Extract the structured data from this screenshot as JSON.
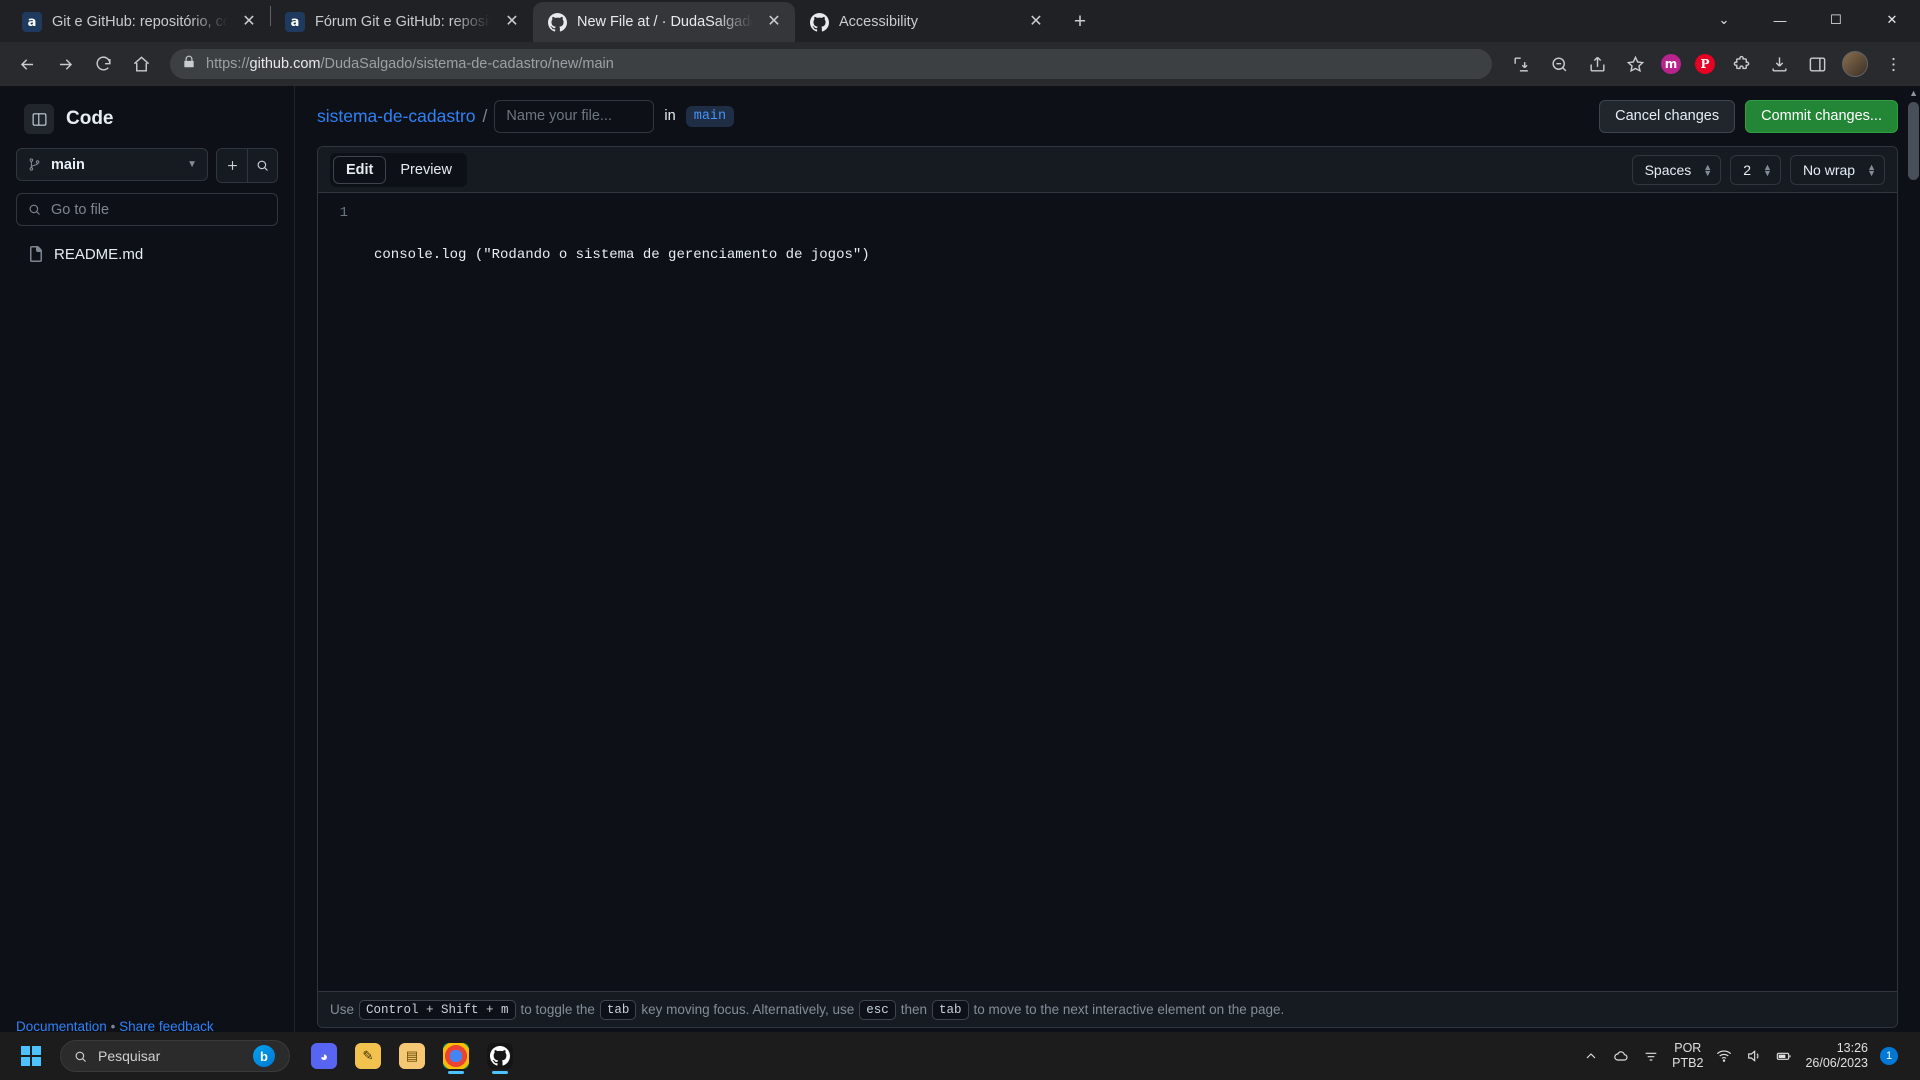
{
  "browser": {
    "tabs": [
      {
        "title": "Git e GitHub: repositório, commit e",
        "favicon": "alura-icon",
        "active": false
      },
      {
        "title": "Fórum Git e GitHub: repositório, com",
        "favicon": "alura-icon",
        "active": false
      },
      {
        "title": "New File at / · DudaSalgado/sistema",
        "favicon": "github-icon",
        "active": true
      },
      {
        "title": "Accessibility",
        "favicon": "github-icon",
        "active": false
      }
    ],
    "new_tab_label": "+",
    "window_controls": {
      "minimize": "—",
      "maximize": "☐",
      "close": "✕",
      "more_tabs": "⌄"
    },
    "toolbar": {
      "back_icon": "back-arrow-icon",
      "forward_icon": "forward-arrow-icon",
      "reload_icon": "reload-icon",
      "home_icon": "home-icon",
      "lock_icon": "lock-icon",
      "url_protocol": "https://",
      "url_domain": "github.com",
      "url_path": "/DudaSalgado/sistema-de-cadastro/new/main",
      "install_icon": "install-app-icon",
      "zoom_icon": "zoom-out-icon",
      "share_icon": "share-icon",
      "bookmark_icon": "star-icon",
      "ext_m_label": "m",
      "ext_p_label": "P",
      "puzzle_icon": "extensions-puzzle-icon",
      "downloads_icon": "downloads-icon",
      "sidepanel_icon": "side-panel-icon",
      "profile_icon": "profile-avatar",
      "menu_icon": "three-dot-menu-icon"
    }
  },
  "github": {
    "sidebar": {
      "panel_toggle_icon": "side-panel-collapse-icon",
      "title": "Code",
      "branch_icon": "git-branch-icon",
      "branch_name": "main",
      "add_file_icon": "plus-icon",
      "search_files_icon": "search-icon",
      "goto_file_icon": "search-icon",
      "goto_file_placeholder": "Go to file",
      "files": [
        {
          "name": "README.md",
          "icon": "file-icon"
        }
      ],
      "footer": {
        "documentation": "Documentation",
        "separator": "•",
        "feedback": "Share feedback"
      }
    },
    "path_bar": {
      "repo": "sistema-de-cadastro",
      "slash": "/",
      "filename_value": "",
      "filename_placeholder": "Name your file...",
      "in_word": "in",
      "branch_chip": "main",
      "cancel_label": "Cancel changes",
      "commit_label": "Commit changes..."
    },
    "editor": {
      "tabs": [
        {
          "label": "Edit",
          "active": true
        },
        {
          "label": "Preview",
          "active": false
        }
      ],
      "indent_mode": "Spaces",
      "indent_size": "2",
      "wrap_mode": "No wrap",
      "lines": [
        {
          "number": "1",
          "text": "console.log (\"Rodando o sistema de gerenciamento de jogos\")"
        }
      ],
      "hint": {
        "part1": "Use",
        "key1": "Control + Shift + m",
        "part2": "to toggle the",
        "key2": "tab",
        "part3": "key moving focus. Alternatively, use",
        "key3": "esc",
        "part4": "then",
        "key4": "tab",
        "part5": "to move to the next interactive element on the page."
      }
    }
  },
  "taskbar": {
    "start_icon": "windows-start-icon",
    "search_placeholder": "Pesquisar",
    "search_icon": "search-icon",
    "bing_label": "b",
    "apps": [
      {
        "name": "discord-icon",
        "glyph": "●",
        "color": "#5865f2",
        "running": false
      },
      {
        "name": "notes-icon",
        "glyph": "✎",
        "color": "#f2c14e",
        "running": false
      },
      {
        "name": "file-explorer-icon",
        "glyph": "▤",
        "color": "#f7c873",
        "running": false
      },
      {
        "name": "chrome-icon",
        "glyph": "◉",
        "color": "#4285f4",
        "running": true
      },
      {
        "name": "github-desktop-icon",
        "glyph": "●",
        "color": "#e6edf3",
        "running": true
      }
    ],
    "tray": {
      "overflow_icon": "chevron-up-icon",
      "cloud_icon": "onedrive-cloud-icon",
      "network_icon": "network-icon",
      "wifi_icon": "wifi-icon",
      "volume_icon": "volume-icon",
      "battery_icon": "battery-icon",
      "lang_line1": "POR",
      "lang_line2": "PTB2",
      "time": "13:26",
      "date": "26/06/2023",
      "notification_count": "1"
    }
  }
}
